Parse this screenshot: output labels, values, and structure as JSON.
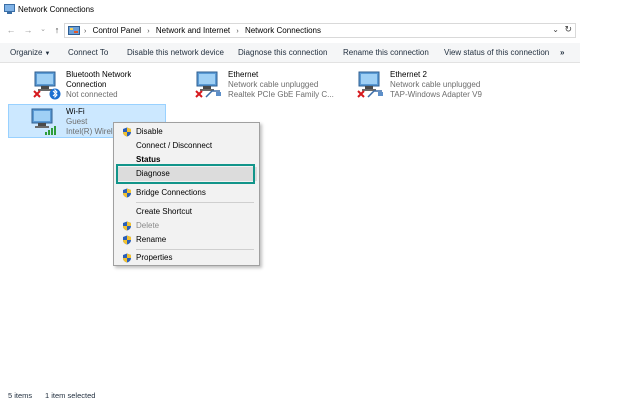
{
  "window": {
    "title": "Network Connections"
  },
  "address": {
    "crumbs": [
      "Control Panel",
      "Network and Internet",
      "Network Connections"
    ]
  },
  "toolbar": {
    "organize": "Organize",
    "connect_to": "Connect To",
    "disable": "Disable this network device",
    "diagnose": "Diagnose this connection",
    "rename": "Rename this connection",
    "view_status": "View status of this connection",
    "more": "»"
  },
  "connections": [
    {
      "name": "Bluetooth Network",
      "name2": "Connection",
      "line2": "Not connected",
      "icon": "bluetooth-network-icon",
      "state": "disconnected"
    },
    {
      "name": "Ethernet",
      "line1": "Network cable unplugged",
      "line2": "Realtek PCIe GbE Family C...",
      "icon": "ethernet-network-icon",
      "state": "unplugged"
    },
    {
      "name": "Ethernet 2",
      "line1": "Network cable unplugged",
      "line2": "TAP-Windows Adapter V9",
      "icon": "ethernet-network-icon",
      "state": "unplugged"
    },
    {
      "name": "Wi-Fi",
      "line1": "Guest",
      "line2": "Intel(R) Wirele",
      "icon": "wifi-network-icon",
      "state": "connected",
      "selected": true
    }
  ],
  "context_menu": {
    "disable": "Disable",
    "connect_disconnect": "Connect / Disconnect",
    "status": "Status",
    "diagnose": "Diagnose",
    "bridge": "Bridge Connections",
    "create_shortcut": "Create Shortcut",
    "delete": "Delete",
    "rename": "Rename",
    "properties": "Properties"
  },
  "statusbar": {
    "items": "5 items",
    "selected": "1 item selected"
  },
  "colors": {
    "selection": "#cce8ff",
    "highlight_box": "#12958a",
    "shield_blue": "#2a5fb8",
    "shield_yellow": "#f2c230",
    "error_red": "#d6191e"
  }
}
